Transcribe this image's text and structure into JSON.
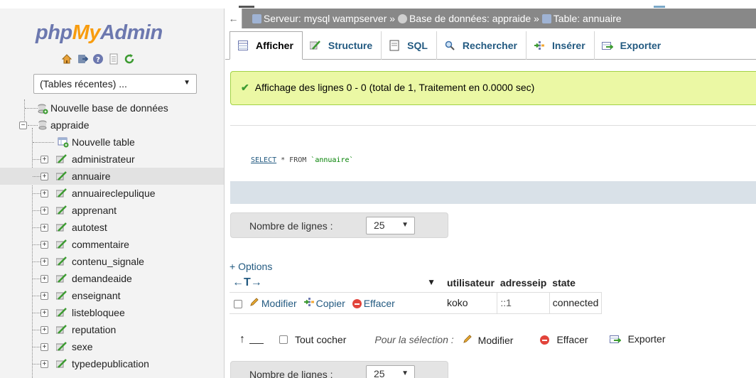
{
  "nav": {
    "logo": {
      "php": "php",
      "my": "My",
      "admin": "Admin"
    },
    "quick_icons": [
      "home-icon",
      "exit-icon",
      "help-icon",
      "docs-icon",
      "reload-icon"
    ],
    "db_select": {
      "value": "(Tables récentes) ..."
    },
    "tree": {
      "new_db": "Nouvelle base de données",
      "database": "appraide",
      "new_table": "Nouvelle table",
      "tables": [
        "administrateur",
        "annuaire",
        "annuaireclepulique",
        "apprenant",
        "autotest",
        "commentaire",
        "contenu_signale",
        "demandeaide",
        "enseignant",
        "listebloquee",
        "reputation",
        "sexe",
        "typedepublication"
      ],
      "selected": "annuaire"
    }
  },
  "breadcrumb": {
    "back": "←",
    "server": "Serveur: mysql wampserver",
    "sep1": "»",
    "database": "Base de données: appraide",
    "sep2": "»",
    "table": "Table: annuaire"
  },
  "tabs": [
    {
      "label": "Afficher",
      "icon": "browse-icon",
      "active": true
    },
    {
      "label": "Structure",
      "icon": "structure-icon",
      "active": false
    },
    {
      "label": "SQL",
      "icon": "sql-icon",
      "active": false
    },
    {
      "label": "Rechercher",
      "icon": "search-icon",
      "active": false
    },
    {
      "label": "Insérer",
      "icon": "insert-icon",
      "active": false
    },
    {
      "label": "Exporter",
      "icon": "export-icon",
      "active": false
    }
  ],
  "message": {
    "text": "Affichage des lignes 0 - 0 (total de 1, Traitement en 0.0000 sec)"
  },
  "query": {
    "select": "SELECT",
    "rest": " * FROM ",
    "table": "`annuaire`"
  },
  "rows_control_top": {
    "label": "Nombre de lignes :",
    "value": "25"
  },
  "rows_control_bottom": {
    "label": "Nombre de lignes :",
    "value": "25"
  },
  "options_link": "+ Options",
  "results": {
    "nav_arrows": "←T→",
    "sort_icon": "▼",
    "columns": [
      "utilisateur",
      "adresseip",
      "state"
    ],
    "rows": [
      {
        "actions": {
          "edit": "Modifier",
          "copy": "Copier",
          "delete": "Effacer"
        },
        "cells": [
          "koko",
          "::1",
          "connected"
        ]
      }
    ]
  },
  "bulk": {
    "check_all": "Tout cocher",
    "for_selection": "Pour la sélection :",
    "edit": "Modifier",
    "delete": "Effacer",
    "export": "Exporter"
  },
  "colors": {
    "link": "#235a81",
    "success_bg": "#ebf8a4",
    "success_border": "#a2d246",
    "breadcrumb_bg": "#888888",
    "logo_blue": "#6c78af",
    "logo_orange": "#f89c0e"
  }
}
